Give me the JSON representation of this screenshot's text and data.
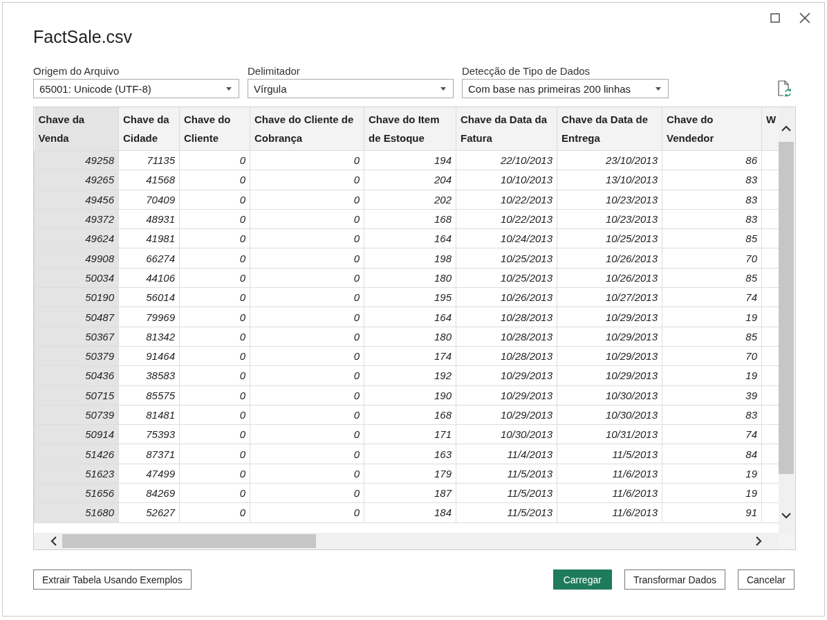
{
  "window": {
    "title": "FactSale.csv"
  },
  "options": [
    {
      "label": "Origem do Arquivo",
      "value": "65001: Unicode (UTF-8)"
    },
    {
      "label": "Delimitador",
      "value": "Vírgula"
    },
    {
      "label": "Detecção de Tipo de Dados",
      "value": "Com base nas primeiras 200 linhas"
    }
  ],
  "table": {
    "columns": [
      {
        "label": "Chave da Venda",
        "selected": true
      },
      {
        "label": "Chave da Cidade",
        "selected": false
      },
      {
        "label": "Chave do Cliente",
        "selected": false
      },
      {
        "label": "Chave do Cliente de Cobrança",
        "selected": false
      },
      {
        "label": "Chave do Item de Estoque",
        "selected": false
      },
      {
        "label": "Chave da Data da Fatura",
        "selected": false
      },
      {
        "label": "Chave da Data de Entrega",
        "selected": false
      },
      {
        "label": "Chave do Vendedor",
        "selected": false
      },
      {
        "label": "W",
        "selected": false
      }
    ],
    "rows": [
      [
        "49258",
        "71135",
        "0",
        "0",
        "194",
        "22/10/2013",
        "23/10/2013",
        "86"
      ],
      [
        "49265",
        "41568",
        "0",
        "0",
        "204",
        "10/10/2013",
        "13/10/2013",
        "83"
      ],
      [
        "49456",
        "70409",
        "0",
        "0",
        "202",
        "10/22/2013",
        "10/23/2013",
        "83"
      ],
      [
        "49372",
        "48931",
        "0",
        "0",
        "168",
        "10/22/2013",
        "10/23/2013",
        "83"
      ],
      [
        "49624",
        "41981",
        "0",
        "0",
        "164",
        "10/24/2013",
        "10/25/2013",
        "85"
      ],
      [
        "49908",
        "66274",
        "0",
        "0",
        "198",
        "10/25/2013",
        "10/26/2013",
        "70"
      ],
      [
        "50034",
        "44106",
        "0",
        "0",
        "180",
        "10/25/2013",
        "10/26/2013",
        "85"
      ],
      [
        "50190",
        "56014",
        "0",
        "0",
        "195",
        "10/26/2013",
        "10/27/2013",
        "74"
      ],
      [
        "50487",
        "79969",
        "0",
        "0",
        "164",
        "10/28/2013",
        "10/29/2013",
        "19"
      ],
      [
        "50367",
        "81342",
        "0",
        "0",
        "180",
        "10/28/2013",
        "10/29/2013",
        "85"
      ],
      [
        "50379",
        "91464",
        "0",
        "0",
        "174",
        "10/28/2013",
        "10/29/2013",
        "70"
      ],
      [
        "50436",
        "38583",
        "0",
        "0",
        "192",
        "10/29/2013",
        "10/29/2013",
        "19"
      ],
      [
        "50715",
        "85575",
        "0",
        "0",
        "190",
        "10/29/2013",
        "10/30/2013",
        "39"
      ],
      [
        "50739",
        "81481",
        "0",
        "0",
        "168",
        "10/29/2013",
        "10/30/2013",
        "83"
      ],
      [
        "50914",
        "75393",
        "0",
        "0",
        "171",
        "10/30/2013",
        "10/31/2013",
        "74"
      ],
      [
        "51426",
        "87371",
        "0",
        "0",
        "163",
        "11/4/2013",
        "11/5/2013",
        "84"
      ],
      [
        "51623",
        "47499",
        "0",
        "0",
        "179",
        "11/5/2013",
        "11/6/2013",
        "19"
      ],
      [
        "51656",
        "84269",
        "0",
        "0",
        "187",
        "11/5/2013",
        "11/6/2013",
        "19"
      ],
      [
        "51680",
        "52627",
        "0",
        "0",
        "184",
        "11/5/2013",
        "11/6/2013",
        "91"
      ]
    ]
  },
  "buttons": [
    {
      "label": "Extrair Tabela Usando Exemplos",
      "kind": "secondary"
    },
    {
      "label": "Carregar",
      "kind": "primary"
    },
    {
      "label": "Transformar Dados",
      "kind": "secondary"
    },
    {
      "label": "Cancelar",
      "kind": "secondary"
    }
  ]
}
